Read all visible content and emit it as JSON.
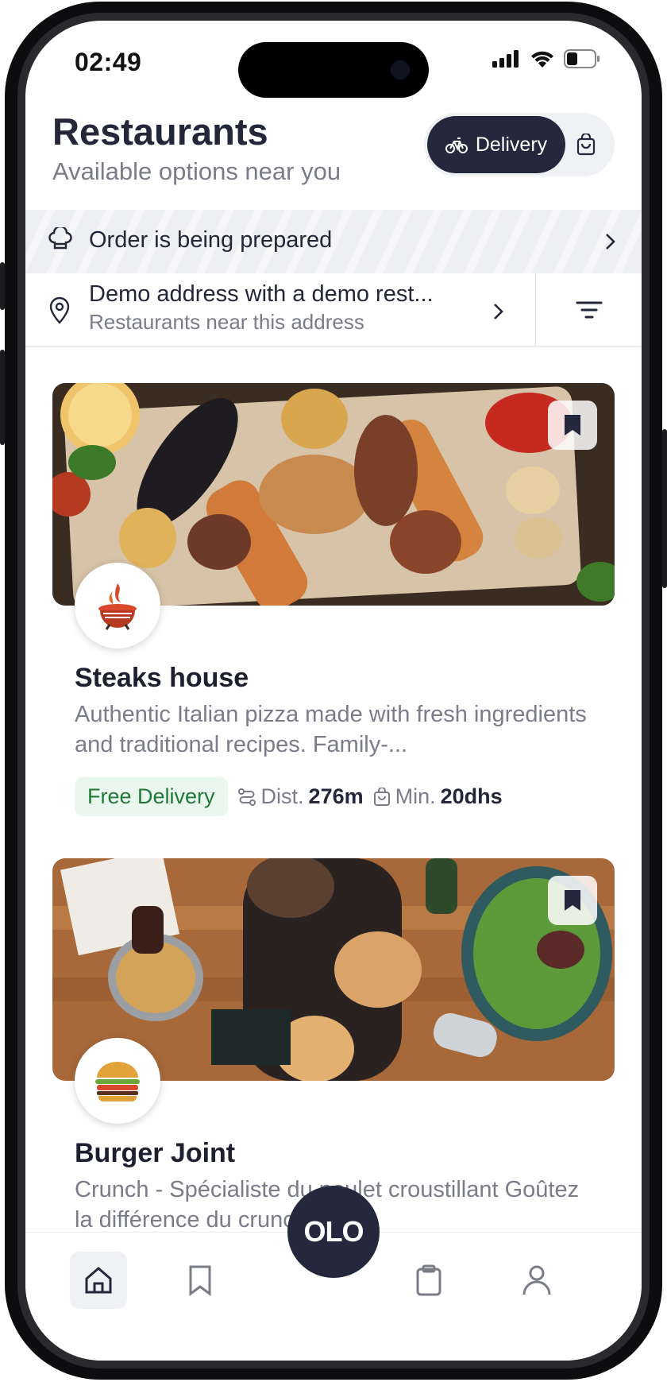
{
  "status_bar": {
    "time": "02:49"
  },
  "header": {
    "title": "Restaurants",
    "subtitle": "Available options near you",
    "delivery_label": "Delivery"
  },
  "order_banner": {
    "text": "Order is being prepared"
  },
  "address": {
    "main": "Demo address with a demo rest...",
    "sub": "Restaurants near this address"
  },
  "restaurants": [
    {
      "name": "Steaks house",
      "description": "Authentic Italian pizza made with fresh ingredients and traditional recipes. Family-...",
      "badge": "Free Delivery",
      "dist_label": "Dist.",
      "dist_value": "276m",
      "min_label": "Min.",
      "min_value": "20dhs",
      "logo_icon": "grill-logo-icon"
    },
    {
      "name": "Burger Joint",
      "description": "Crunch - Spécialiste du poulet croustillant Goûtez la différence du crunch.",
      "logo_icon": "burger-logo-icon"
    }
  ],
  "fab_label": "OLO",
  "bottom_nav": [
    "home-icon",
    "bookmark-icon",
    "orders-icon",
    "profile-icon"
  ],
  "colors": {
    "primary": "#25273d",
    "muted": "#7a7c88",
    "free_bg": "#eaf7ee",
    "free_text": "#217a3a"
  }
}
